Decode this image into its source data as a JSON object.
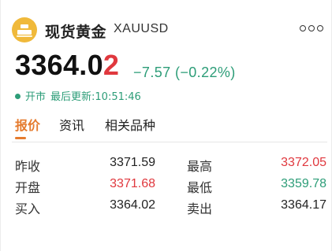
{
  "header": {
    "title": "现货黄金",
    "symbol": "XAUUSD",
    "icon": "gold-bars-icon",
    "more_icon": "more-dots-icon"
  },
  "price": {
    "main": "3364.0",
    "last_digit": "2",
    "change": "−7.57 (−0.22%)"
  },
  "status": {
    "state": "开市",
    "updated": "最后更新:10:51:46"
  },
  "tabs": [
    {
      "label": "报价",
      "active": true
    },
    {
      "label": "资讯",
      "active": false
    },
    {
      "label": "相关品种",
      "active": false
    }
  ],
  "quotes": [
    {
      "label1": "昨收",
      "value1": "3371.59",
      "color1": "#222222",
      "label2": "最高",
      "value2": "3372.05",
      "color2": "#e0383e"
    },
    {
      "label1": "开盘",
      "value1": "3371.68",
      "color1": "#e0383e",
      "label2": "最低",
      "value2": "3359.78",
      "color2": "#2d9d78"
    },
    {
      "label1": "买入",
      "value1": "3364.02",
      "color1": "#222222",
      "label2": "卖出",
      "value2": "3364.17",
      "color2": "#222222"
    }
  ],
  "colors": {
    "up": "#e0383e",
    "down": "#2d9d78",
    "accent": "#e57b2e",
    "gold": "#f0b93a"
  }
}
